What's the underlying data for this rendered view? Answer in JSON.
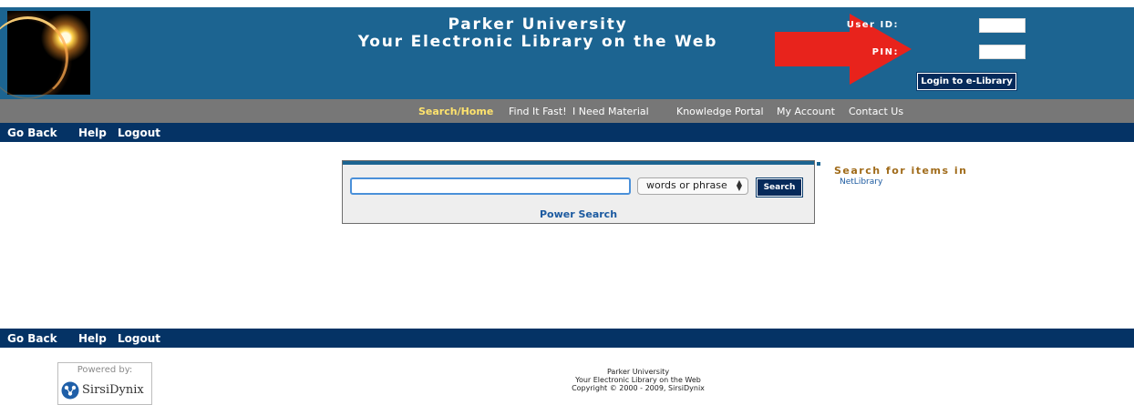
{
  "header": {
    "title_line1": "Parker University",
    "title_line2": "Your Electronic Library on the Web",
    "userid_label": "User ID:",
    "pin_label": "PIN:",
    "login_button": "Login to e-Library",
    "arrow_color": "#e8231c"
  },
  "nav": {
    "items": [
      {
        "label": "Search/Home"
      },
      {
        "label": "Find It Fast!"
      },
      {
        "label": "I Need Material"
      },
      {
        "label": "Knowledge Portal"
      },
      {
        "label": "My Account"
      },
      {
        "label": "Contact Us"
      }
    ]
  },
  "toolbar": {
    "go_back": "Go Back",
    "help": "Help",
    "logout": "Logout"
  },
  "search": {
    "input_value": "",
    "select_value": "words or phrase",
    "button": "Search",
    "power_search": "Power Search"
  },
  "sidebar": {
    "heading": "Search for items in",
    "link": "NetLibrary"
  },
  "footer": {
    "powered_by": "Powered by:",
    "vendor": "SirsiDynix",
    "line1": "Parker University",
    "line2": "Your Electronic Library on the Web",
    "line3": "Copyright © 2000 - 2009, SirsiDynix"
  },
  "colors": {
    "header_blue": "#1c6491",
    "dark_navy": "#053365",
    "nav_gray": "#777777",
    "active_nav": "#ffe36d",
    "heading_brown": "#a06b1a"
  }
}
